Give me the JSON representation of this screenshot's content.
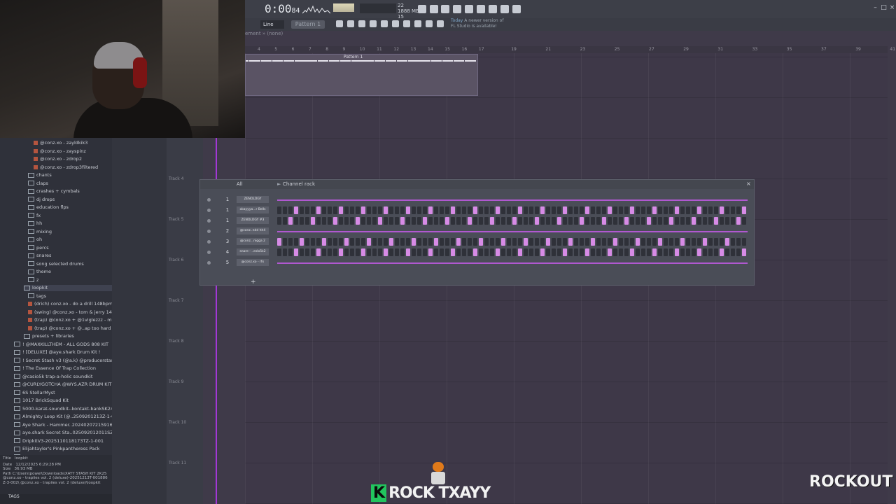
{
  "toolbar": {
    "time": "0:00",
    "time_small": "84",
    "cpu": [
      "22",
      "1888 MB",
      "15"
    ],
    "line_label": "Line",
    "pattern_label": "Pattern 1",
    "hint_line1": "Today",
    "hint_line1b": "A newer version of",
    "hint_line2": "FL Studio is available!"
  },
  "playlist": {
    "arrangement": "ement » (none)",
    "ruler": [
      "4",
      "5",
      "6",
      "7",
      "8",
      "9",
      "10",
      "11",
      "12",
      "13",
      "14",
      "15",
      "16",
      "17",
      "19",
      "21",
      "23",
      "25",
      "27",
      "29",
      "31",
      "33",
      "35",
      "37",
      "39",
      "41"
    ],
    "pattern_clip": "Pattern 1",
    "tracks": [
      "Track 4",
      "Track 5",
      "Track 6",
      "Track 7",
      "Track 8",
      "Track 9",
      "Track 10",
      "Track 11"
    ]
  },
  "browser": {
    "items": [
      {
        "label": "@conz.xo - zayldkik3",
        "kind": "audio"
      },
      {
        "label": "@conz.xo - zayspinz",
        "kind": "audio"
      },
      {
        "label": "@conz.xo - zdrop2",
        "kind": "audio"
      },
      {
        "label": "@conz.xo - zdrop3filtered",
        "kind": "audio"
      },
      {
        "label": "chants",
        "kind": "folder"
      },
      {
        "label": "claps",
        "kind": "folder"
      },
      {
        "label": "crashes + cymbals",
        "kind": "folder"
      },
      {
        "label": "dj drops",
        "kind": "folder"
      },
      {
        "label": "education flps",
        "kind": "folder"
      },
      {
        "label": "fx",
        "kind": "folder"
      },
      {
        "label": "hh",
        "kind": "folder"
      },
      {
        "label": "mixing",
        "kind": "folder"
      },
      {
        "label": "oh",
        "kind": "folder"
      },
      {
        "label": "percs",
        "kind": "folder"
      },
      {
        "label": "snares",
        "kind": "folder"
      },
      {
        "label": "song selected drums",
        "kind": "folder"
      },
      {
        "label": "theme",
        "kind": "folder"
      },
      {
        "label": "z",
        "kind": "folder"
      },
      {
        "label": "loopkit",
        "kind": "folder"
      },
      {
        "label": "tags",
        "kind": "folder"
      },
      {
        "label": "(drich) conz.xo - do a drill 148bpm",
        "kind": "audio"
      },
      {
        "label": "(swing) @conz.xo - tom & jerry 140bpm",
        "kind": "audio"
      },
      {
        "label": "(trap) @conz.xo + @1viglezzz - my bad 145bpm",
        "kind": "audio"
      },
      {
        "label": "(trap) @conz.xo + @..ap too hard 148bpm",
        "kind": "audio"
      },
      {
        "label": "presets + libraries",
        "kind": "folder"
      },
      {
        "label": "! @MAXKILLTHEM - ALL GODS 808 KIT",
        "kind": "folder"
      },
      {
        "label": "! [DELUXE] @aye.shark Drum Kit !",
        "kind": "folder"
      },
      {
        "label": "! Secret Stash v3 (@a.k) @producerstash.com",
        "kind": "folder"
      },
      {
        "label": "! The Essence Of Trap Collection",
        "kind": "folder"
      },
      {
        "label": "@casio5k trap-a-holic soundkit",
        "kind": "folder"
      },
      {
        "label": "@CURLYGOTCHA @WYS.AZR DRUM KIT [200+]",
        "kind": "folder"
      },
      {
        "label": "6S StellarMyst",
        "kind": "folder"
      },
      {
        "label": "1017 BrickSquad Kit",
        "kind": "folder"
      },
      {
        "label": "5000-karat-soundkit--kontakt-bankSK2410SS",
        "kind": "folder"
      },
      {
        "label": "Almighty Loop Kit (@..2509201213Z-1-001",
        "kind": "folder"
      },
      {
        "label": "Aye Shark - Hammer..20240207215916Z-001",
        "kind": "folder"
      },
      {
        "label": "aye.shark Secret Sta..025092012011SZ-1-001",
        "kind": "folder"
      },
      {
        "label": "DripkitV3-2025110118173TZ-1-001",
        "kind": "folder"
      },
      {
        "label": "Elijahtayler's Pinkpantheress Pack",
        "kind": "folder"
      },
      {
        "label": "Gucci Kit V5",
        "kind": "folder"
      }
    ],
    "info_title_label": "Title",
    "info_title": "loopkit",
    "info_date_label": "Date",
    "info_date": "12/12/2025 6:29:28 PM",
    "info_size_label": "Size",
    "info_size": "36.93 MB",
    "info_path_label": "Path",
    "info_path": "C:\\Users\\powel\\Downloads\\XAYY STASH KIT 2K25 @conz.xo - trapiies vol. 2 (deluxe)-20251213T-001886Z-3-002\\ @conz.xo - trapiies vol. 2 (deluxe)\\loopkit",
    "tags_label": "TAGS"
  },
  "channel_rack": {
    "title": "Channel rack",
    "filter": "All",
    "channels": [
      {
        "num": "1",
        "name": "ZENOLOGY",
        "mode": "roll"
      },
      {
        "num": "1",
        "name": "okayyya...r Bells",
        "mode": "steps"
      },
      {
        "num": "1",
        "name": "ZENOLOGY #3",
        "mode": "steps"
      },
      {
        "num": "2",
        "name": "@conz..ndd hh4",
        "mode": "roll"
      },
      {
        "num": "3",
        "name": "@conz...nigga 2",
        "mode": "steps"
      },
      {
        "num": "4",
        "name": "snare - ..eslo5k2",
        "mode": "steps"
      },
      {
        "num": "5",
        "name": "@conz.xo - rfx",
        "mode": "roll"
      }
    ],
    "add_label": "+"
  },
  "branding": {
    "left_k": "K",
    "left_text": "ROCK TXAYY",
    "right_text": "ROCKOUT"
  },
  "colors": {
    "accent": "#b058d0",
    "step_on": "#d78be6",
    "playhead": "#a238d6"
  }
}
